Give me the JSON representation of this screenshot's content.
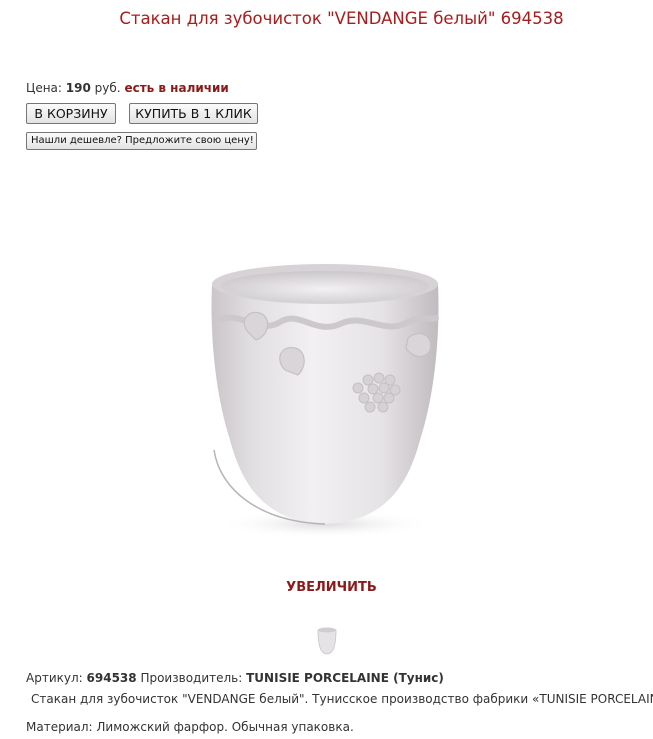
{
  "product": {
    "title": "Стакан для зубочисток \"VENDANGE белый\" 694538",
    "price_label": "Цена:",
    "price_value": "190",
    "price_currency": "руб.",
    "stock_status": "есть в наличии",
    "image_icon": "white-porcelain-cup-image",
    "thumbnail_icon": "cup-thumbnail-image"
  },
  "actions": {
    "add_to_cart": "В КОРЗИНУ",
    "buy_one_click": "КУПИТЬ В 1 КЛИК",
    "found_cheaper": "Нашли дешевле? Предложите свою цену!",
    "zoom": "УВЕЛИЧИТЬ"
  },
  "details": {
    "article_label": "Артикул:",
    "article_value": "694538",
    "manufacturer_label": "Производитель:",
    "manufacturer_value": "TUNISIE PORCELAINE (Тунис)",
    "description": "Стакан для зубочисток \"VENDANGE белый\". Тунисское производство фабрики «TUNISIE PORCELAINE».",
    "material": "Материал: Лиможский фарфор. Обычная упаковка."
  },
  "colors": {
    "title": "#a71d1d",
    "accent": "#8b1a1a",
    "text": "#333333"
  }
}
